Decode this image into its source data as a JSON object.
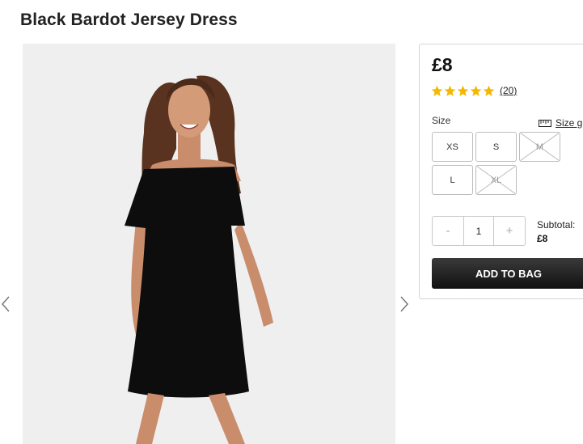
{
  "product": {
    "title": "Black Bardot Jersey Dress",
    "price": "£8",
    "rating": 5,
    "review_count": "(20)"
  },
  "image": {
    "alt": "Woman wearing black bardot jersey dress"
  },
  "sizes": {
    "label": "Size",
    "guide_label": "Size g",
    "options": [
      {
        "label": "XS",
        "available": true
      },
      {
        "label": "S",
        "available": true
      },
      {
        "label": "M",
        "available": false
      },
      {
        "label": "L",
        "available": true
      },
      {
        "label": "XL",
        "available": false
      }
    ]
  },
  "quantity": {
    "minus": "-",
    "value": "1",
    "plus": "+"
  },
  "subtotal": {
    "label": "Subtotal:",
    "value": "£8"
  },
  "add_to_bag": "ADD TO BAG",
  "colors": {
    "star": "#f5b800",
    "button": "#1a1a1a"
  }
}
